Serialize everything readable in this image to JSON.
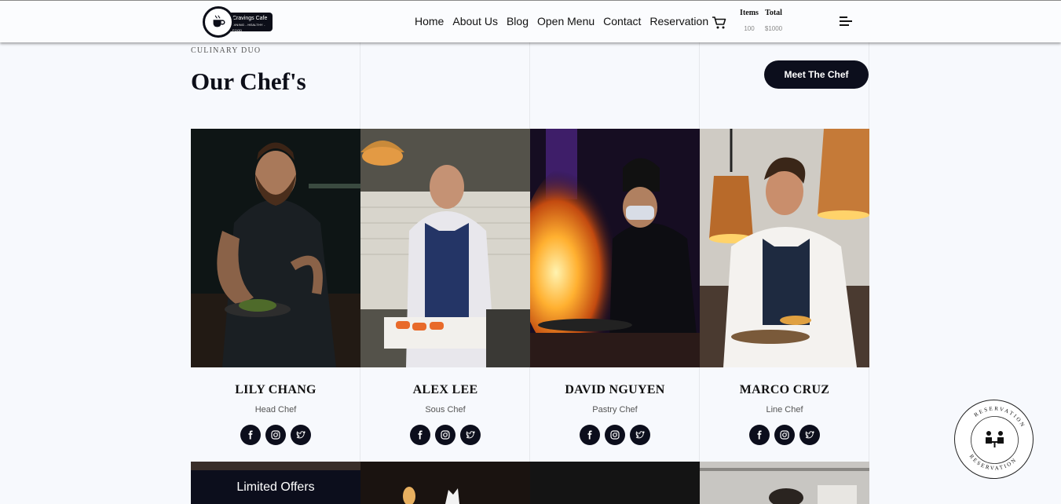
{
  "header": {
    "logo": {
      "name": "Cravings Cafe",
      "tagline": "DINING - HEALTHY - FOOD"
    },
    "nav": [
      "Home",
      "About Us",
      "Blog",
      "Open Menu",
      "Contact",
      "Reservation"
    ],
    "items_label": "Items",
    "items_value": "100",
    "total_label": "Total",
    "total_value": "$1000"
  },
  "section": {
    "eyebrow": "CULINARY DUO",
    "title": "Our Chef's",
    "cta": "Meet The Chef"
  },
  "chefs": [
    {
      "name": "LILY CHANG",
      "role": "Head Chef"
    },
    {
      "name": "ALEX LEE",
      "role": "Sous Chef"
    },
    {
      "name": "DAVID NGUYEN",
      "role": "Pastry Chef"
    },
    {
      "name": "MARCO CRUZ",
      "role": "Line Chef"
    }
  ],
  "offers": {
    "label": "Limited Offers"
  },
  "reservation_badge": {
    "text": "RESERVATION"
  },
  "colors": {
    "dark": "#0c0e1c",
    "background": "#f7f9fd"
  }
}
